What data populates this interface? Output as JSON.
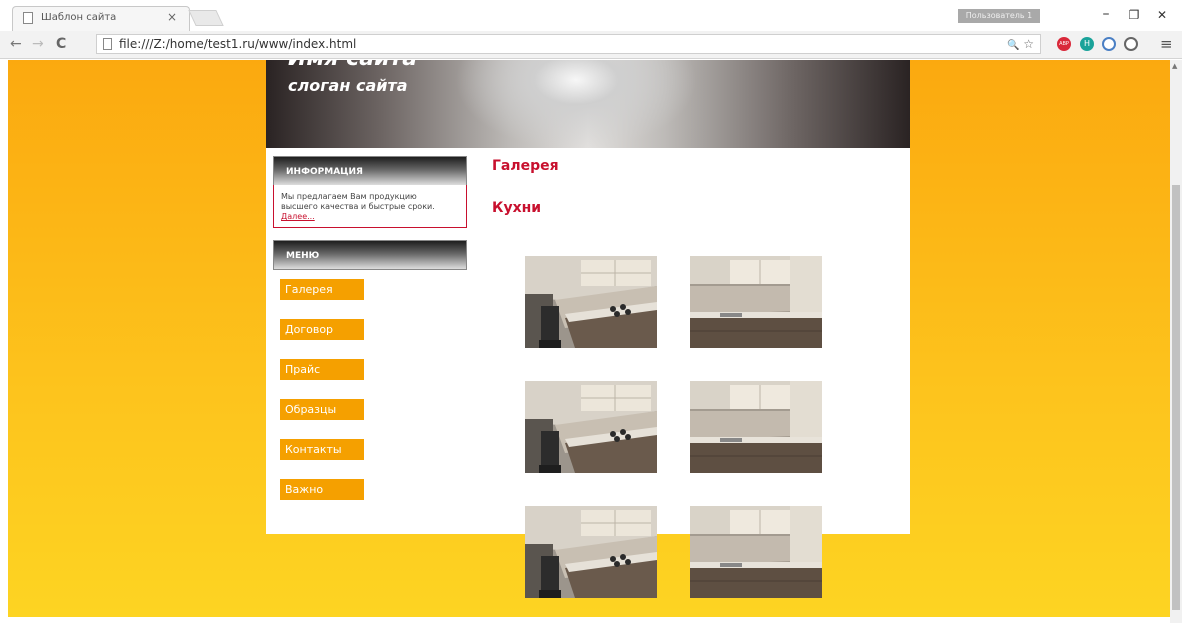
{
  "browser": {
    "tab_title": "Шаблон сайта",
    "tab_close": "×",
    "user_button": "Пользователь 1",
    "url": "file:///Z:/home/test1.ru/www/index.html",
    "win_minimize": "–",
    "win_restore": "❐",
    "win_close": "✕",
    "back": "←",
    "forward": "→",
    "reload": "C",
    "zoom_icon": "🔍",
    "star_icon": "☆",
    "menu_icon": "≡",
    "ext_abp": "ABP",
    "ext_h": "H"
  },
  "site": {
    "name": "Имя сайта",
    "slogan": "слоган сайта"
  },
  "sidebar": {
    "info_heading": "информация",
    "info_text": "Мы предлагаем Вам продукцию высшего качества и быстрые сроки. ",
    "info_link": "Далее...",
    "menu_heading": "меню",
    "menu_items": [
      {
        "label": "Галерея"
      },
      {
        "label": "Договор"
      },
      {
        "label": "Прайс"
      },
      {
        "label": "Образцы"
      },
      {
        "label": "Контакты"
      },
      {
        "label": "Важно"
      }
    ]
  },
  "content": {
    "heading": "Галерея",
    "subheading": "Кухни",
    "photos": [
      {
        "name": "kitchen-photo-1"
      },
      {
        "name": "kitchen-photo-2"
      },
      {
        "name": "kitchen-photo-3"
      },
      {
        "name": "kitchen-photo-4"
      },
      {
        "name": "kitchen-photo-5"
      },
      {
        "name": "kitchen-photo-6"
      }
    ]
  },
  "colors": {
    "accent_red": "#c8102e",
    "menu_orange": "#f5a000",
    "background_top": "#fba90f",
    "background_bottom": "#fdd422"
  }
}
